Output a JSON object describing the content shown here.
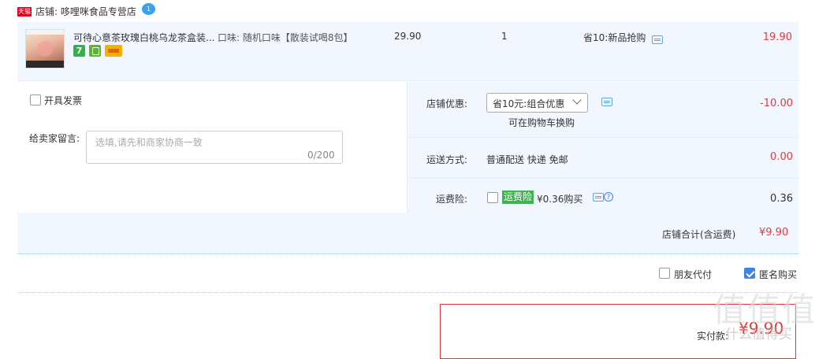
{
  "shop": {
    "badge": "天猫",
    "label": "店铺: 哆哩咪食品专营店",
    "wangwang_badge": "1"
  },
  "item": {
    "title": "可待心意茶玫瑰白桃乌龙茶盒装...",
    "sku": "口味: 随机口味【散装试喝8包】",
    "service_icons": [
      "7-day-return-icon",
      "guarantee-icon",
      "credit-card-icon"
    ],
    "service_badge_text": "7",
    "price": "29.90",
    "qty": "1",
    "promo": "省10:新品抢购",
    "subtotal": "19.90"
  },
  "invoice": {
    "label": "开具发票",
    "checked": false
  },
  "message": {
    "label": "给卖家留言:",
    "placeholder": "选填,请先和商家协商一致",
    "count": "0/200"
  },
  "discount": {
    "label": "店铺优惠:",
    "selected": "省10元:组合优惠",
    "hint": "可在购物车换购",
    "amount": "-10.00"
  },
  "shipping": {
    "label": "运送方式:",
    "method": "普通配送 快递 免邮",
    "amount": "0.00"
  },
  "insurance": {
    "label": "运费险:",
    "tag": "运费险",
    "price_text": "¥0.36购买",
    "amount": "0.36",
    "checked": false
  },
  "shop_total": {
    "label": "店铺合计(含运费)",
    "value": "¥9.90"
  },
  "options": {
    "friend_pay": "朋友代付",
    "friend_pay_checked": false,
    "anonymous": "匿名购买",
    "anonymous_checked": true
  },
  "payment": {
    "label": "实付款:",
    "value": "¥9.90"
  },
  "watermark": {
    "text": "值值值",
    "sub": "什么值得买"
  },
  "colors": {
    "accent_red": "#e4393c",
    "row_bg": "#f2f7ff",
    "tmall_red": "#d7011c",
    "insurance_green": "#3fb34f",
    "checkbox_blue": "#3d84e6"
  }
}
